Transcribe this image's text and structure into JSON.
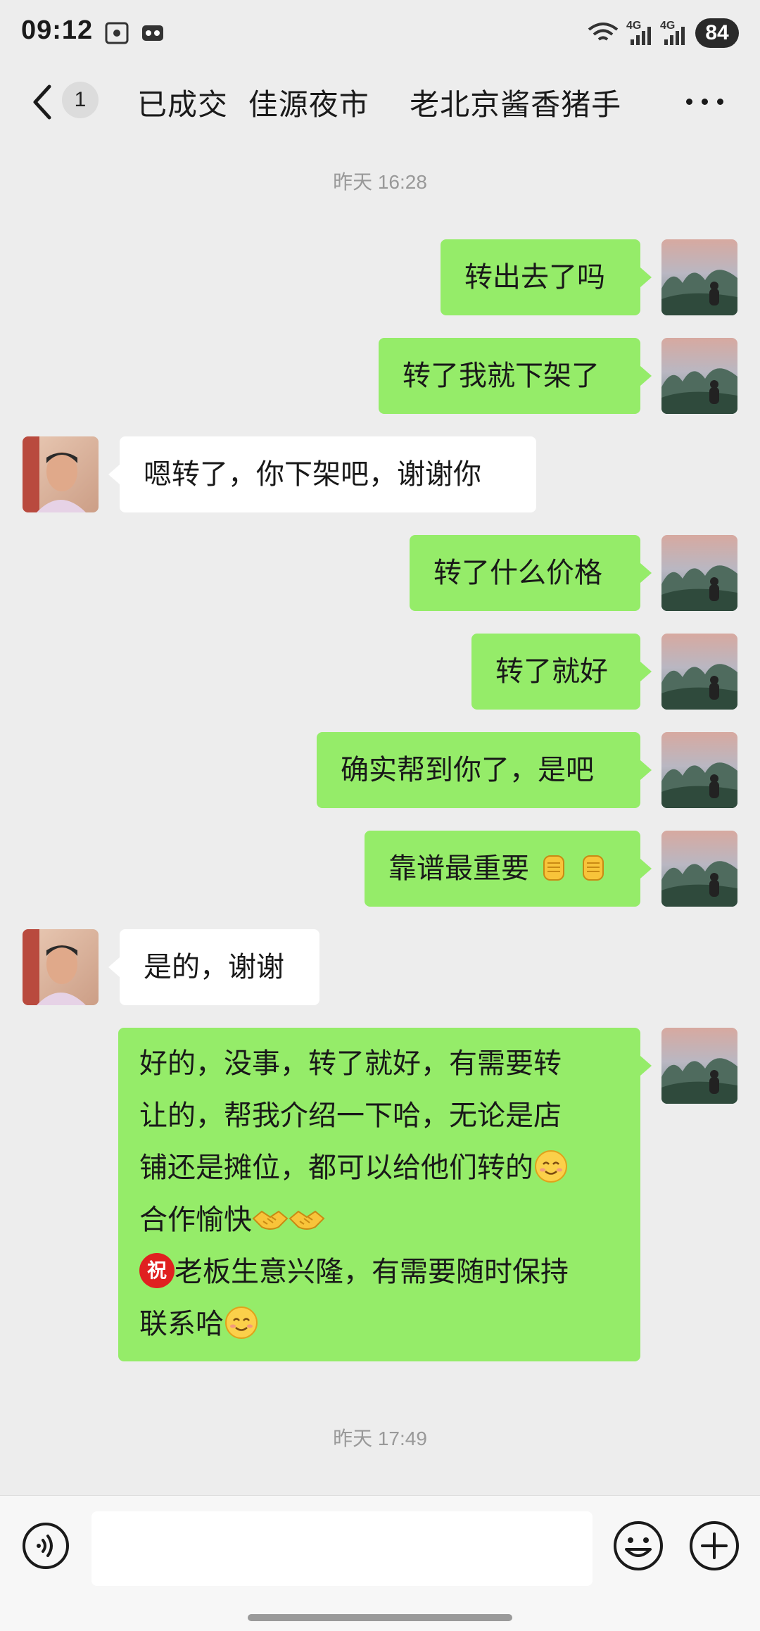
{
  "status_bar": {
    "time": "09:12",
    "net1": "4G",
    "net2": "4G",
    "battery": "84"
  },
  "nav": {
    "unread_count": "1",
    "title": "已成交  佳源夜市    老北京酱香猪手"
  },
  "timestamps": [
    "昨天 16:28",
    "昨天 17:49"
  ],
  "messages": [
    {
      "side": "me",
      "text": "转出去了吗"
    },
    {
      "side": "me",
      "text": "转了我就下架了"
    },
    {
      "side": "them",
      "text": "嗯转了，你下架吧，谢谢你"
    },
    {
      "side": "me",
      "text": "转了什么价格"
    },
    {
      "side": "me",
      "text": "转了就好"
    },
    {
      "side": "me",
      "text": "确实帮到你了，是吧"
    },
    {
      "side": "me",
      "text": "靠谱最重要",
      "emojis": [
        "raised-fist-emoji",
        "raised-fist-emoji"
      ]
    },
    {
      "side": "them",
      "text": "是的，谢谢"
    },
    {
      "side": "me",
      "lines": [
        "好的，没事，转了就好，有需要转",
        "让的，帮我介绍一下哈，无论是店",
        "铺还是摊位，都可以给他们转的",
        "合作愉快",
        "老板生意兴隆，有需要随时保持",
        "联系哈"
      ]
    }
  ],
  "emoji_glyphs": {
    "zhu": "祝"
  },
  "colors": {
    "bubble_me": "#95ec69",
    "bubble_them": "#ffffff",
    "background": "#ededed"
  },
  "icons": [
    "back-icon",
    "more-icon",
    "voice-icon",
    "emoji-icon",
    "plus-icon"
  ]
}
